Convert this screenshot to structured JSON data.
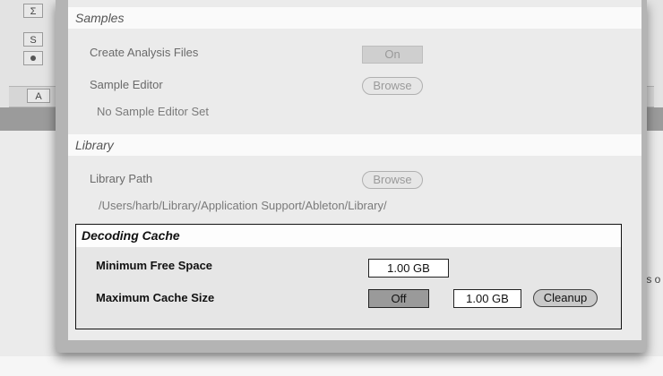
{
  "background": {
    "track_buttons": [
      "Σ",
      "S"
    ],
    "bar_letter": "A",
    "right_snippet": "cts o"
  },
  "samples": {
    "header": "Samples",
    "create_analysis_label": "Create Analysis Files",
    "create_analysis_value": "On",
    "sample_editor_label": "Sample Editor",
    "sample_editor_button": "Browse",
    "sample_editor_status": "No Sample Editor Set"
  },
  "library": {
    "header": "Library",
    "path_label": "Library Path",
    "path_button": "Browse",
    "path_value": "/Users/harb/Library/Application Support/Ableton/Library/"
  },
  "decoding_cache": {
    "header": "Decoding Cache",
    "min_free_label": "Minimum Free Space",
    "min_free_value": "1.00 GB",
    "max_cache_label": "Maximum Cache Size",
    "max_cache_toggle": "Off",
    "max_cache_value": "1.00 GB",
    "cleanup_button": "Cleanup"
  },
  "colors": {
    "panel_bg": "#ebebeb",
    "header_bg": "#fafafa",
    "highlight_border": "#111111",
    "dim_text": "#6a6a6a"
  }
}
